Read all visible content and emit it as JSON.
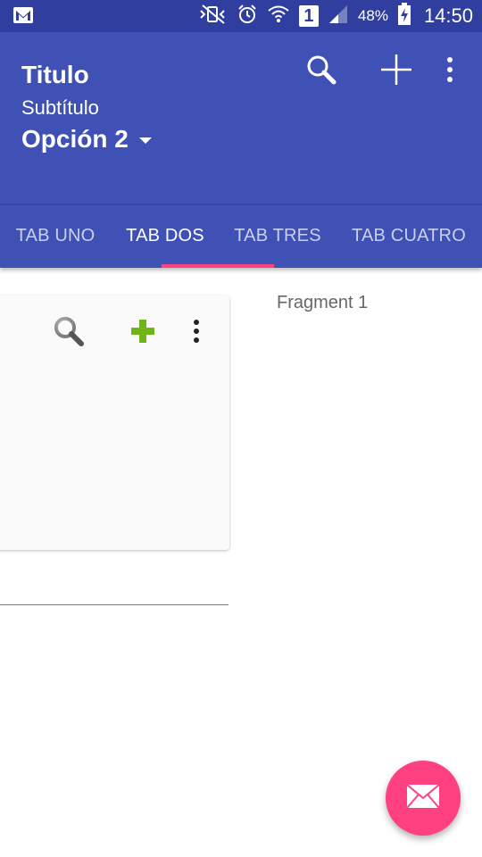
{
  "status_bar": {
    "battery_percent": "48%",
    "time": "14:50",
    "sim_number": "1",
    "icons": [
      "gmail-icon",
      "mute-vibrate-icon",
      "alarm-icon",
      "wifi-icon",
      "sim-icon",
      "signal-icon",
      "battery-charging-icon"
    ]
  },
  "app_bar": {
    "title": "Titulo",
    "subtitle": "Subtítulo",
    "spinner_value": "Opción 2",
    "actions": [
      "search-icon",
      "add-icon",
      "overflow-menu-icon"
    ],
    "color": "#3F51B5"
  },
  "tabs": {
    "items": [
      "TAB UNO",
      "TAB DOS",
      "TAB TRES",
      "TAB CUATRO"
    ],
    "selected": "TAB DOS",
    "indicator_color": "#FF4081"
  },
  "card": {
    "actions": [
      "search-icon",
      "add-icon",
      "overflow-menu-icon"
    ]
  },
  "fragment": {
    "label": "Fragment 1"
  },
  "fab": {
    "icon": "mail-icon",
    "color": "#FF4081"
  }
}
